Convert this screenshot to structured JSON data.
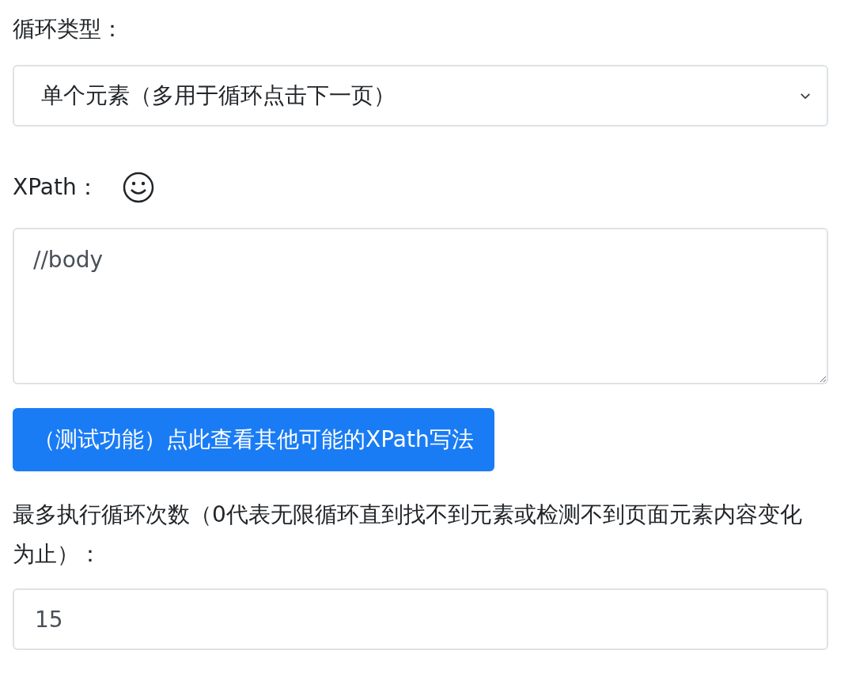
{
  "loop_type": {
    "label": "循环类型：",
    "value": "单个元素（多用于循环点击下一页）"
  },
  "xpath": {
    "label": "XPath：",
    "value": "//body"
  },
  "test_button": "（测试功能）点此查看其他可能的XPath写法",
  "max_loops": {
    "label": "最多执行循环次数（0代表无限循环直到找不到元素或检测不到页面元素内容变化为止）：",
    "value": "15"
  }
}
